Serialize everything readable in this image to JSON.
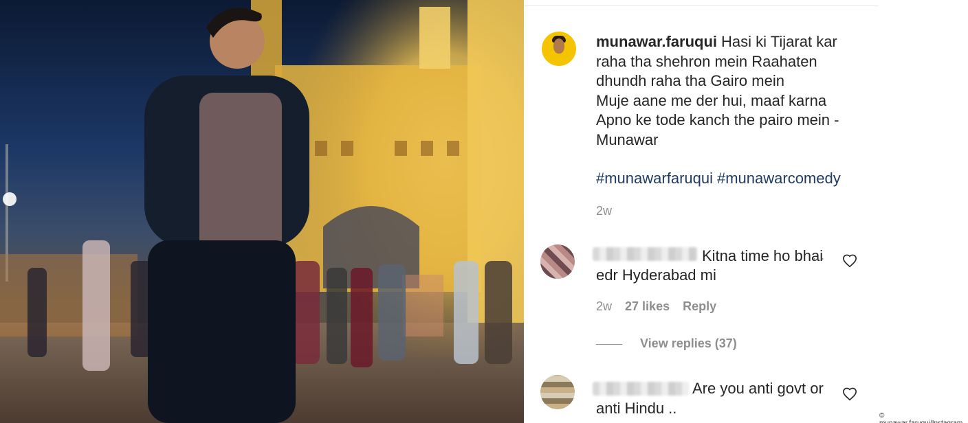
{
  "post": {
    "username": "munawar.faruqui",
    "caption": "Hasi ki Tijarat kar raha tha shehron mein Raahaten dhundh raha tha Gairo mein\nMuje aane me der hui, maaf karna\nApno ke tode kanch the pairo mein -\nMunawar",
    "hashtags": [
      "#munawarfaruqui",
      "#munawarcomedy"
    ],
    "age": "2w"
  },
  "comments": [
    {
      "text_line1": "Kitna time ho bhai",
      "text_line2": "edr Hyderabad mi",
      "age": "2w",
      "likes": "27 likes",
      "reply": "Reply",
      "view_replies": "View replies (37)",
      "more": "..."
    },
    {
      "text_line1": "Are you anti govt or",
      "text_line2": "anti Hindu .."
    }
  ],
  "credit": "© munawar.faruqui/Instagram",
  "colors": {
    "hashtag": "#1f3b63",
    "muted": "#8e8e8e",
    "avatar_bg": "#f5c400"
  },
  "icons": [
    "heart-icon",
    "more-options-icon"
  ]
}
